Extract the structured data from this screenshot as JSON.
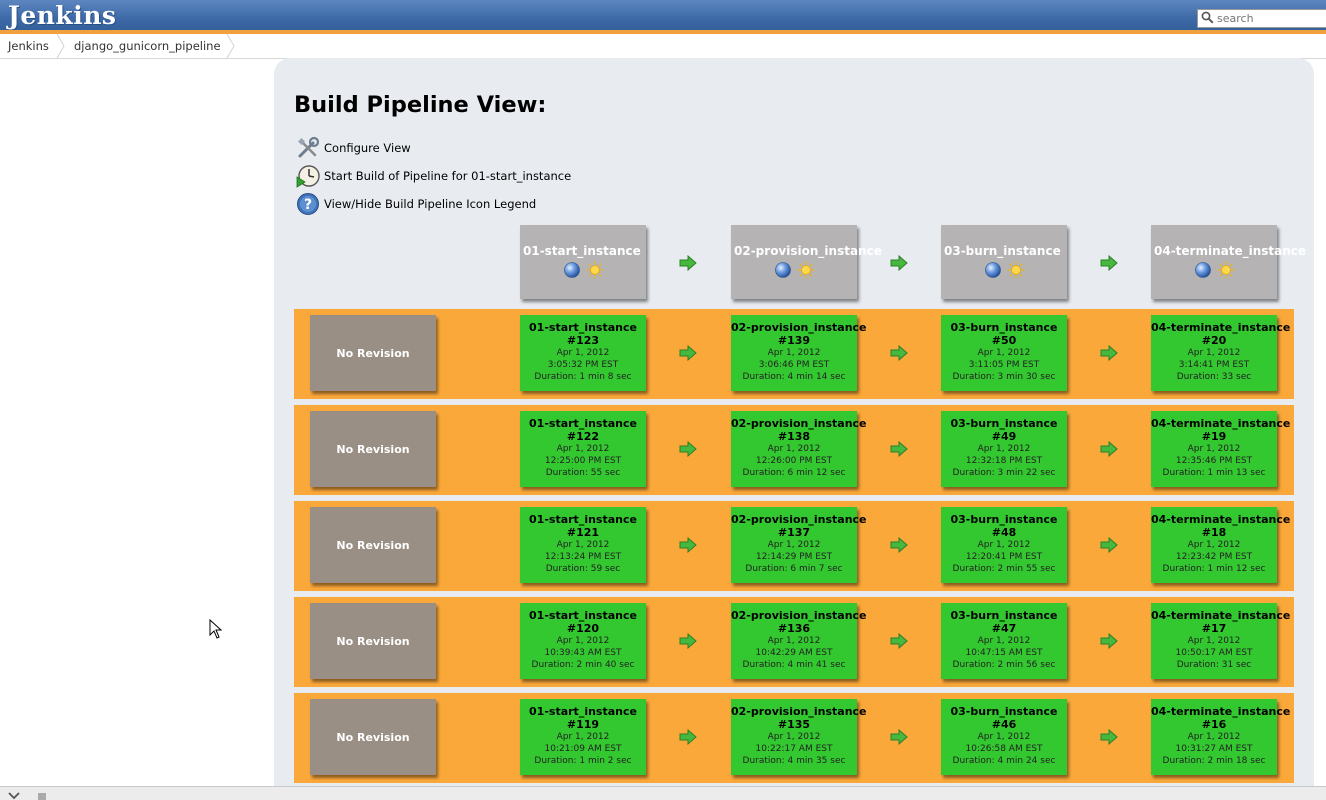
{
  "header": {
    "logo": "Jenkins",
    "search_placeholder": "search"
  },
  "breadcrumbs": [
    {
      "label": "Jenkins"
    },
    {
      "label": "django_gunicorn_pipeline"
    }
  ],
  "view": {
    "title": "Build Pipeline View:",
    "actions": [
      {
        "label": "Configure View",
        "icon": "configure-icon"
      },
      {
        "label": "Start Build of Pipeline for 01-start_instance",
        "icon": "clock-start-icon"
      },
      {
        "label": "View/Hide Build Pipeline Icon Legend",
        "icon": "help-icon"
      }
    ]
  },
  "pipeline": {
    "jobs": [
      {
        "name": "01-start_instance"
      },
      {
        "name": "02-provision_instance"
      },
      {
        "name": "03-burn_instance"
      },
      {
        "name": "04-terminate_instance"
      }
    ],
    "revision_label": "No Revision",
    "rows": [
      {
        "builds": [
          {
            "name": "01-start_instance",
            "number": "#123",
            "date": "Apr 1, 2012",
            "time": "3:05:32 PM EST",
            "duration": "Duration: 1 min 8 sec"
          },
          {
            "name": "02-provision_instance",
            "number": "#139",
            "date": "Apr 1, 2012",
            "time": "3:06:46 PM EST",
            "duration": "Duration: 4 min 14 sec"
          },
          {
            "name": "03-burn_instance",
            "number": "#50",
            "date": "Apr 1, 2012",
            "time": "3:11:05 PM EST",
            "duration": "Duration: 3 min 30 sec"
          },
          {
            "name": "04-terminate_instance",
            "number": "#20",
            "date": "Apr 1, 2012",
            "time": "3:14:41 PM EST",
            "duration": "Duration: 33 sec"
          }
        ]
      },
      {
        "builds": [
          {
            "name": "01-start_instance",
            "number": "#122",
            "date": "Apr 1, 2012",
            "time": "12:25:00 PM EST",
            "duration": "Duration: 55 sec"
          },
          {
            "name": "02-provision_instance",
            "number": "#138",
            "date": "Apr 1, 2012",
            "time": "12:26:00 PM EST",
            "duration": "Duration: 6 min 12 sec"
          },
          {
            "name": "03-burn_instance",
            "number": "#49",
            "date": "Apr 1, 2012",
            "time": "12:32:18 PM EST",
            "duration": "Duration: 3 min 22 sec"
          },
          {
            "name": "04-terminate_instance",
            "number": "#19",
            "date": "Apr 1, 2012",
            "time": "12:35:46 PM EST",
            "duration": "Duration: 1 min 13 sec"
          }
        ]
      },
      {
        "builds": [
          {
            "name": "01-start_instance",
            "number": "#121",
            "date": "Apr 1, 2012",
            "time": "12:13:24 PM EST",
            "duration": "Duration: 59 sec"
          },
          {
            "name": "02-provision_instance",
            "number": "#137",
            "date": "Apr 1, 2012",
            "time": "12:14:29 PM EST",
            "duration": "Duration: 6 min 7 sec"
          },
          {
            "name": "03-burn_instance",
            "number": "#48",
            "date": "Apr 1, 2012",
            "time": "12:20:41 PM EST",
            "duration": "Duration: 2 min 55 sec"
          },
          {
            "name": "04-terminate_instance",
            "number": "#18",
            "date": "Apr 1, 2012",
            "time": "12:23:42 PM EST",
            "duration": "Duration: 1 min 12 sec"
          }
        ]
      },
      {
        "builds": [
          {
            "name": "01-start_instance",
            "number": "#120",
            "date": "Apr 1, 2012",
            "time": "10:39:43 AM EST",
            "duration": "Duration: 2 min 40 sec"
          },
          {
            "name": "02-provision_instance",
            "number": "#136",
            "date": "Apr 1, 2012",
            "time": "10:42:29 AM EST",
            "duration": "Duration: 4 min 41 sec"
          },
          {
            "name": "03-burn_instance",
            "number": "#47",
            "date": "Apr 1, 2012",
            "time": "10:47:15 AM EST",
            "duration": "Duration: 2 min 56 sec"
          },
          {
            "name": "04-terminate_instance",
            "number": "#17",
            "date": "Apr 1, 2012",
            "time": "10:50:17 AM EST",
            "duration": "Duration: 31 sec"
          }
        ]
      },
      {
        "builds": [
          {
            "name": "01-start_instance",
            "number": "#119",
            "date": "Apr 1, 2012",
            "time": "10:21:09 AM EST",
            "duration": "Duration: 1 min 2 sec"
          },
          {
            "name": "02-provision_instance",
            "number": "#135",
            "date": "Apr 1, 2012",
            "time": "10:22:17 AM EST",
            "duration": "Duration: 4 min 35 sec"
          },
          {
            "name": "03-burn_instance",
            "number": "#46",
            "date": "Apr 1, 2012",
            "time": "10:26:58 AM EST",
            "duration": "Duration: 4 min 24 sec"
          },
          {
            "name": "04-terminate_instance",
            "number": "#16",
            "date": "Apr 1, 2012",
            "time": "10:31:27 AM EST",
            "duration": "Duration: 2 min 18 sec"
          }
        ]
      }
    ]
  },
  "colors": {
    "header_blue": "#3d6aa8",
    "header_accent": "#f0a13d",
    "row_orange": "#fba83a",
    "build_success": "#33c830",
    "revision_box": "#9a8f84",
    "job_header": "#b5b3b3",
    "panel_bg": "#e8ecf1"
  },
  "status_icons": [
    "blue-ball-icon",
    "sunny-weather-icon"
  ]
}
